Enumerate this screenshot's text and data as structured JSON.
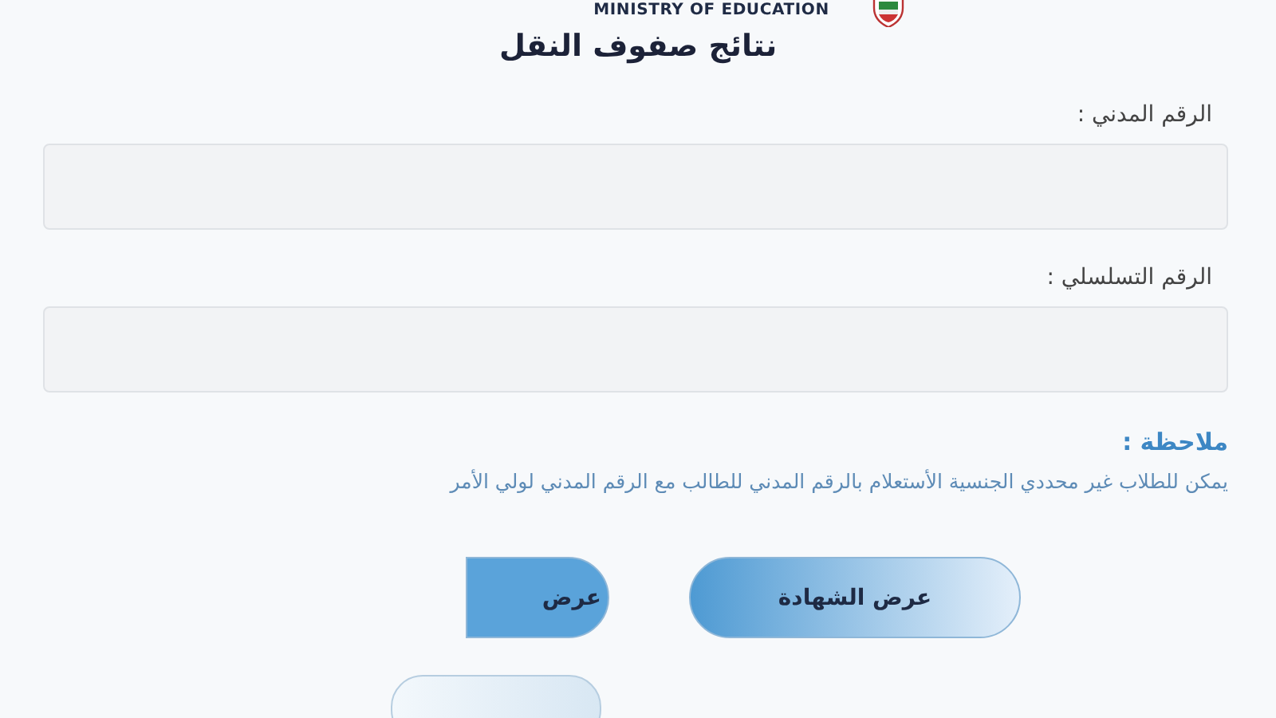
{
  "header": {
    "logo_text": "MINISTRY OF EDUCATION",
    "title": "نتائج صفوف النقل"
  },
  "fields": [
    {
      "label": "الرقم المدني :"
    },
    {
      "label": "الرقم التسلسلي :"
    }
  ],
  "note": {
    "title": "ملاحظة :",
    "text": "يمكن للطلاب غير محددي الجنسية الأستعلام بالرقم المدني للطالب مع الرقم المدني لولي الأمر"
  },
  "buttons": [
    {
      "label": "عرض الشهادة"
    },
    {
      "label": "عرض"
    }
  ]
}
